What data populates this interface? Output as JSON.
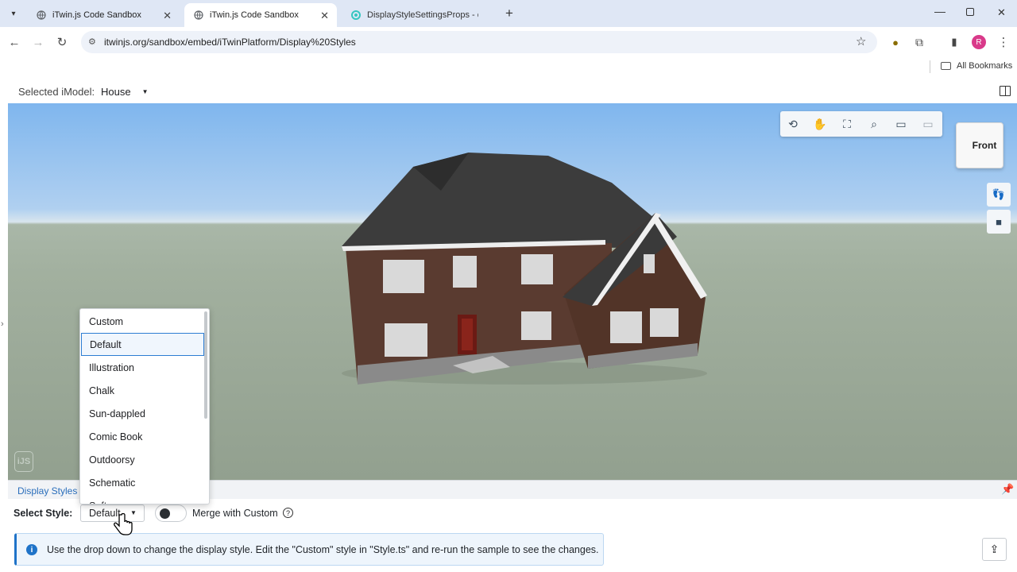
{
  "browser": {
    "tabs": [
      {
        "title": "iTwin.js Code Sandbox",
        "active": false,
        "icon": "globe-icon"
      },
      {
        "title": "iTwin.js Code Sandbox",
        "active": true,
        "icon": "globe-icon"
      },
      {
        "title": "DisplayStyleSettingsProps - cor",
        "active": false,
        "icon": "itwin-favicon-icon"
      }
    ],
    "new_tab": "+",
    "url": "itwinjs.org/sandbox/embed/iTwinPlatform/Display%20Styles",
    "bookmarks_label": "All Bookmarks",
    "profile_initial": "R"
  },
  "app": {
    "imodel_label": "Selected iModel:",
    "imodel_value": "House",
    "navcube_face": "Front",
    "panel_title": "Display Styles Se",
    "select_label": "Select Style:",
    "select_value": "Default",
    "merge_label": "Merge with Custom",
    "merge_toggle_on": false,
    "info_text": "Use the drop down to change the display style. Edit the \"Custom\" style in \"Style.ts\" and re-run the sample to see the changes.",
    "dropdown_options": [
      "Custom",
      "Default",
      "Illustration",
      "Chalk",
      "Sun-dappled",
      "Comic Book",
      "Outdoorsy",
      "Schematic",
      "Soft"
    ],
    "dropdown_selected": "Default"
  },
  "colors": {
    "accent": "#2d7dd2",
    "info_bar": "#1f73c8",
    "sky": "#7fb6ee",
    "ground": "#a2b09f"
  }
}
